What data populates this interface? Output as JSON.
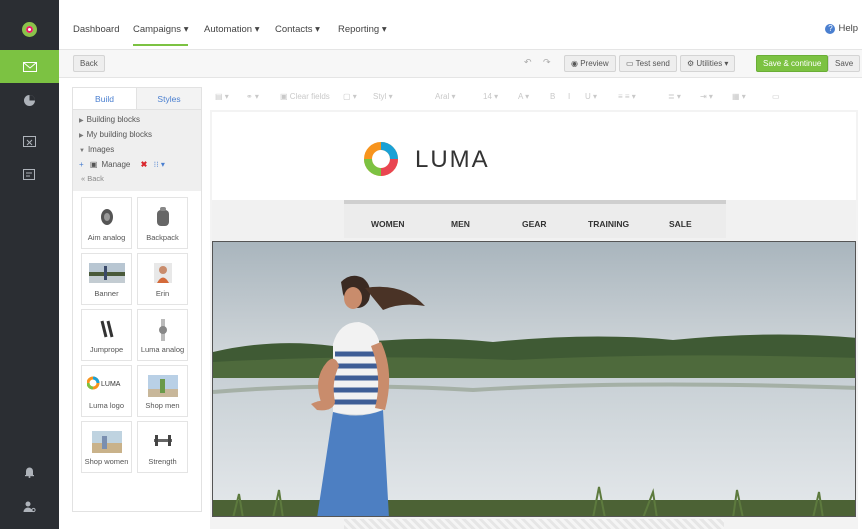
{
  "rail": {
    "items": [
      {
        "icon": "luma-logo-icon"
      },
      {
        "icon": "envelope-icon",
        "active": true
      },
      {
        "icon": "pie-chart-icon"
      },
      {
        "icon": "calendar-x-icon"
      },
      {
        "icon": "report-icon"
      },
      {
        "icon": "bell-icon"
      },
      {
        "icon": "user-settings-icon"
      }
    ]
  },
  "topnav": {
    "items": [
      "Dashboard",
      "Campaigns ▾",
      "Automation ▾",
      "Contacts ▾",
      "Reporting ▾"
    ],
    "active_index": 1,
    "help": "Help"
  },
  "toolbar": {
    "back": "Back",
    "preview": "Preview",
    "test_send": "Test send",
    "utilities": "Utilities ▾",
    "save_continue": "Save & continue",
    "save": "Save"
  },
  "panel": {
    "tabs": [
      "Build",
      "Styles"
    ],
    "tree": [
      "Building blocks",
      "My building blocks",
      "Images"
    ],
    "manage": "Manage",
    "back": "« Back",
    "tiles": [
      "Aim analog",
      "Backpack",
      "Banner",
      "Erin",
      "Jumprope",
      "Luma analog",
      "Luma logo",
      "Shop men",
      "Shop women",
      "Strength"
    ]
  },
  "editor_toolbar": {
    "items": [
      "Clear fields",
      "Styl",
      "Aral",
      "14"
    ]
  },
  "email": {
    "logo_text": "LUMA",
    "menu": [
      "WOMEN",
      "MEN",
      "GEAR",
      "TRAINING",
      "SALE"
    ]
  },
  "colors": {
    "accent": "#7cc242",
    "rail": "#2b2e33",
    "link": "#4a7fd0"
  }
}
